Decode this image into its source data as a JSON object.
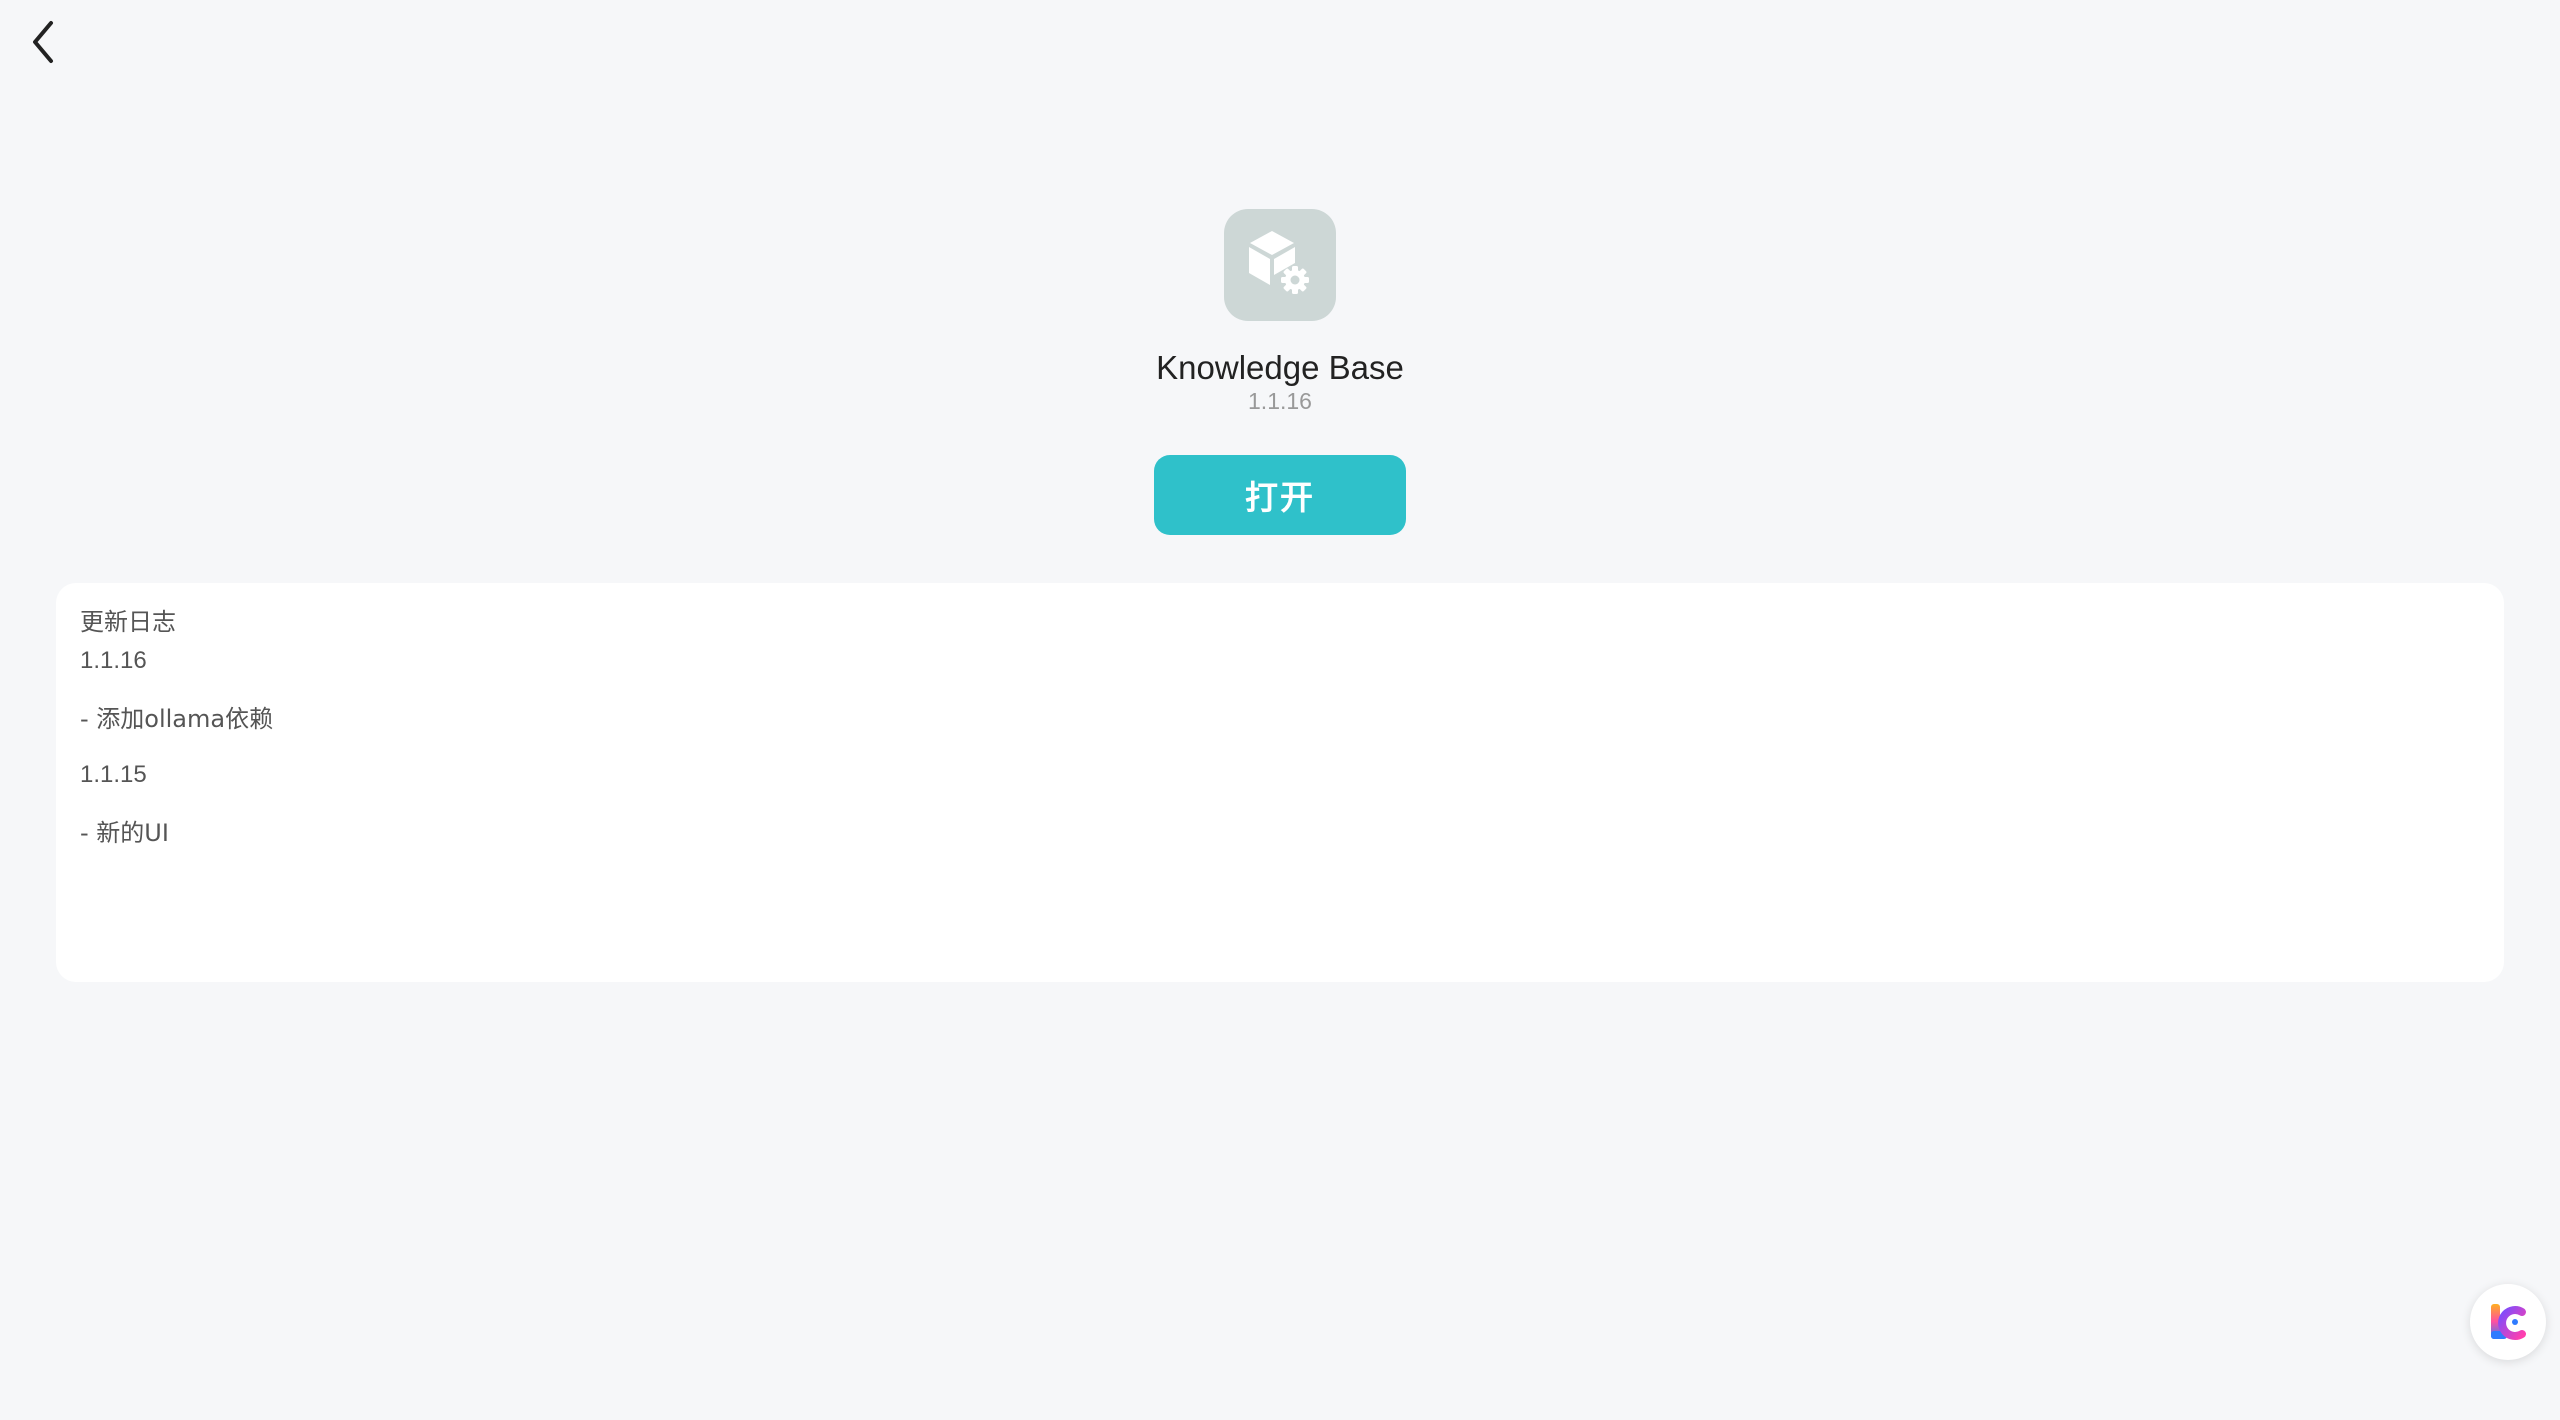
{
  "app": {
    "name": "Knowledge Base",
    "version": "1.1.16",
    "icon": "box-gear-icon",
    "open_label": "打开"
  },
  "nav": {
    "back_icon": "chevron-left-icon"
  },
  "changelog": {
    "title": "更新日志",
    "entries": [
      {
        "version": "1.1.16",
        "note": "- 添加ollama依赖"
      },
      {
        "version": "1.1.15",
        "note": "- 新的UI"
      }
    ]
  },
  "assistant": {
    "icon": "lc-logo-icon"
  },
  "colors": {
    "background": "#f6f7f9",
    "accent": "#2fc1ca",
    "icon_tile": "#cdd7d6",
    "card": "#ffffff"
  }
}
